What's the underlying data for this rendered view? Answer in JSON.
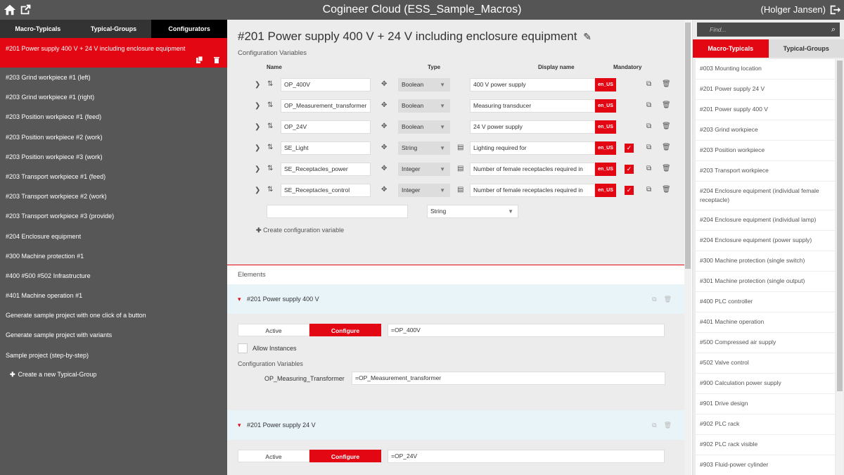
{
  "header": {
    "title": "Cogineer Cloud (ESS_Sample_Macros)",
    "user": "(Holger Jansen)",
    "icons": [
      "home-icon",
      "export-icon",
      "logout-icon"
    ]
  },
  "left": {
    "tabs": [
      "Macro-Typicals",
      "Typical-Groups",
      "Configurators"
    ],
    "selected": "#201 Power supply 400 V + 24 V including enclosure equipment",
    "items": [
      "#203 Grind workpiece #1 (left)",
      "#203 Grind workpiece #1 (right)",
      "#203 Position workpiece #1 (feed)",
      "#203 Position workpiece #2 (work)",
      "#203 Position workpiece #3 (work)",
      "#203 Transport workpiece #1 (feed)",
      "#203 Transport workpiece #2 (work)",
      "#203 Transport workpiece #3 (provide)",
      "#204 Enclosure equipment",
      "#300 Machine protection #1",
      "#400 #500 #502 Infrastructure",
      "#401 Machine operation #1",
      "Generate sample project with one click of a button",
      "Generate sample project with variants",
      "Sample project (step-by-step)"
    ],
    "create_label": "Create a new Typical-Group"
  },
  "config": {
    "title": "#201 Power supply 400 V + 24 V including enclosure equipment",
    "section_label": "Configuration Variables",
    "columns": {
      "name": "Name",
      "type": "Type",
      "display": "Display name",
      "mandatory": "Mandatory"
    },
    "vars": [
      {
        "name": "OP_400V",
        "type": "Boolean",
        "display": "400 V power supply",
        "lang": "en_US",
        "mandatory": false,
        "list": false
      },
      {
        "name": "OP_Measurement_transformer",
        "type": "Boolean",
        "display": "Measuring transducer",
        "lang": "en_US",
        "mandatory": false,
        "list": false
      },
      {
        "name": "OP_24V",
        "type": "Boolean",
        "display": "24 V power supply",
        "lang": "en_US",
        "mandatory": false,
        "list": false
      },
      {
        "name": "SE_Light",
        "type": "String",
        "display": "Lighting required for",
        "lang": "en_US",
        "mandatory": true,
        "list": true
      },
      {
        "name": "SE_Receptacles_power",
        "type": "Integer",
        "display": "Number of female receptacles required in",
        "lang": "en_US",
        "mandatory": true,
        "list": true
      },
      {
        "name": "SE_Receptacles_control",
        "type": "Integer",
        "display": "Number of female receptacles required in",
        "lang": "en_US",
        "mandatory": true,
        "list": true
      }
    ],
    "new_var": {
      "name": "",
      "type": "String"
    },
    "create_label": "Create configuration variable"
  },
  "elements": {
    "section_label": "Elements",
    "items": [
      {
        "title": "#201 Power supply 400 V",
        "active_label": "Active",
        "configure_label": "Configure",
        "expression": "=OP_400V",
        "allow_label": "Allow Instances",
        "cv_label": "Configuration Variables",
        "cv_name": "OP_Measuring_Transformer",
        "cv_value": "=OP_Measurement_transformer"
      },
      {
        "title": "#201 Power supply 24 V",
        "active_label": "Active",
        "configure_label": "Configure",
        "expression": "=OP_24V"
      }
    ]
  },
  "right": {
    "search_placeholder": "Find...",
    "tabs": [
      "Macro-Typicals",
      "Typical-Groups"
    ],
    "items": [
      "#003 Mounting location",
      "#201 Power supply 24 V",
      "#201 Power supply 400 V",
      "#203 Grind workpiece",
      "#203 Position workpiece",
      "#203 Transport workpiece",
      "#204 Enclosure equipment (individual female receptacle)",
      "#204 Enclosure equipment (individual lamp)",
      "#204 Enclosure equipment (power supply)",
      "#300 Machine protection (single switch)",
      "#301 Machine protection (single output)",
      "#400 PLC controller",
      "#401 Machine operation",
      "#500 Compressed air supply",
      "#502 Valve control",
      "#900 Calculation power supply",
      "#901 Drive design",
      "#902 PLC rack",
      "#902 PLC rack visible",
      "#903 Fluid-power cylinder"
    ]
  },
  "colors": {
    "accent": "#e30613",
    "header": "#555555",
    "sidebar": "#575757"
  }
}
